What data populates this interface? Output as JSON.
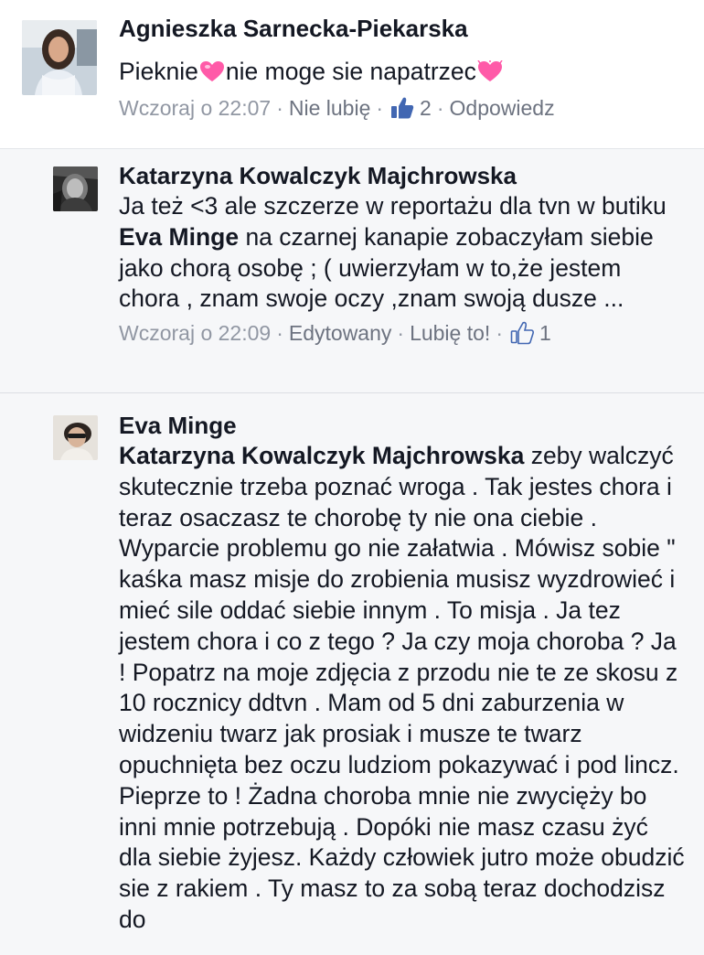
{
  "comments": [
    {
      "author": "Agnieszka Sarnecka-Piekarska",
      "text_a": "Pieknie",
      "text_b": "nie moge sie napatrzec",
      "heart_icon": "pink-heart-icon",
      "time": "Wczoraj o 22:07",
      "action1": "Nie lubię",
      "like_count": "2",
      "action2": "Odpowiedz"
    },
    {
      "author": "Katarzyna Kowalczyk Majchrowska",
      "text_a": "Ja też <3 ale szczerze w reportażu dla tvn w butiku ",
      "mention": "Eva Minge",
      "text_b": " na czarnej kanapie zobaczyłam siebie jako chorą osobę ; ( uwierzyłam w to,że jestem chora , znam swoje oczy ,znam swoją dusze ...",
      "time": "Wczoraj o 22:09",
      "edited": "Edytowany",
      "action1": "Lubię to!",
      "like_count": "1"
    },
    {
      "author": "Eva Minge",
      "mention": "Katarzyna Kowalczyk Majchrowska",
      "text": " zeby walczyć skutecznie trzeba poznać wroga . Tak jestes chora i teraz osaczasz te chorobę ty nie ona ciebie . Wyparcie problemu go nie załatwia . Mówisz sobie \" kaśka masz misje do zrobienia musisz wyzdrowieć i mieć sile oddać siebie innym . To misja . Ja tez jestem chora i co z tego ? Ja czy moja choroba ? Ja ! Popatrz na moje zdjęcia z przodu  nie te ze skosu z 10 rocznicy ddtvn . Mam od 5 dni zaburzenia w widzeniu twarz jak prosiak i musze te twarz opuchnięta bez oczu ludziom pokazywać i pod lincz. Pieprze to ! Żadna choroba mnie nie zwycięży bo inni mnie potrzebują . Dopóki nie masz czasu żyć dla siebie żyjesz. Każdy człowiek jutro może obudzić sie z rakiem . Ty masz to za sobą teraz dochodzisz do"
    }
  ],
  "icons": {
    "like": "thumbs-up-icon",
    "accent": "#4267b2",
    "heart": "#ff4fa3"
  }
}
